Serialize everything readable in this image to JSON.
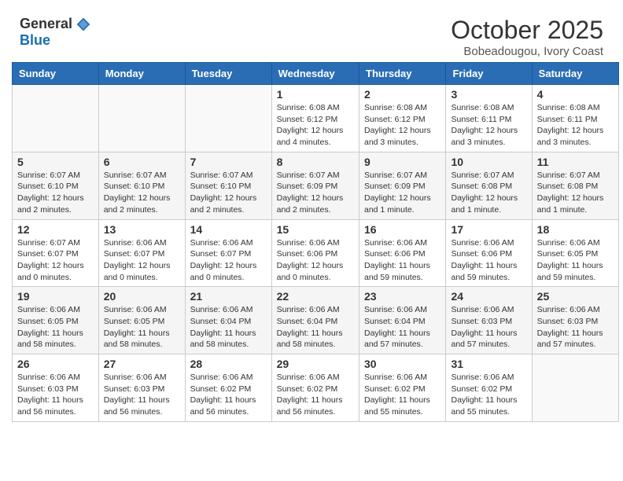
{
  "header": {
    "logo_general": "General",
    "logo_blue": "Blue",
    "month_title": "October 2025",
    "location": "Bobeadougou, Ivory Coast"
  },
  "days_of_week": [
    "Sunday",
    "Monday",
    "Tuesday",
    "Wednesday",
    "Thursday",
    "Friday",
    "Saturday"
  ],
  "weeks": [
    [
      {
        "day": "",
        "info": ""
      },
      {
        "day": "",
        "info": ""
      },
      {
        "day": "",
        "info": ""
      },
      {
        "day": "1",
        "info": "Sunrise: 6:08 AM\nSunset: 6:12 PM\nDaylight: 12 hours\nand 4 minutes."
      },
      {
        "day": "2",
        "info": "Sunrise: 6:08 AM\nSunset: 6:12 PM\nDaylight: 12 hours\nand 3 minutes."
      },
      {
        "day": "3",
        "info": "Sunrise: 6:08 AM\nSunset: 6:11 PM\nDaylight: 12 hours\nand 3 minutes."
      },
      {
        "day": "4",
        "info": "Sunrise: 6:08 AM\nSunset: 6:11 PM\nDaylight: 12 hours\nand 3 minutes."
      }
    ],
    [
      {
        "day": "5",
        "info": "Sunrise: 6:07 AM\nSunset: 6:10 PM\nDaylight: 12 hours\nand 2 minutes."
      },
      {
        "day": "6",
        "info": "Sunrise: 6:07 AM\nSunset: 6:10 PM\nDaylight: 12 hours\nand 2 minutes."
      },
      {
        "day": "7",
        "info": "Sunrise: 6:07 AM\nSunset: 6:10 PM\nDaylight: 12 hours\nand 2 minutes."
      },
      {
        "day": "8",
        "info": "Sunrise: 6:07 AM\nSunset: 6:09 PM\nDaylight: 12 hours\nand 2 minutes."
      },
      {
        "day": "9",
        "info": "Sunrise: 6:07 AM\nSunset: 6:09 PM\nDaylight: 12 hours\nand 1 minute."
      },
      {
        "day": "10",
        "info": "Sunrise: 6:07 AM\nSunset: 6:08 PM\nDaylight: 12 hours\nand 1 minute."
      },
      {
        "day": "11",
        "info": "Sunrise: 6:07 AM\nSunset: 6:08 PM\nDaylight: 12 hours\nand 1 minute."
      }
    ],
    [
      {
        "day": "12",
        "info": "Sunrise: 6:07 AM\nSunset: 6:07 PM\nDaylight: 12 hours\nand 0 minutes."
      },
      {
        "day": "13",
        "info": "Sunrise: 6:06 AM\nSunset: 6:07 PM\nDaylight: 12 hours\nand 0 minutes."
      },
      {
        "day": "14",
        "info": "Sunrise: 6:06 AM\nSunset: 6:07 PM\nDaylight: 12 hours\nand 0 minutes."
      },
      {
        "day": "15",
        "info": "Sunrise: 6:06 AM\nSunset: 6:06 PM\nDaylight: 12 hours\nand 0 minutes."
      },
      {
        "day": "16",
        "info": "Sunrise: 6:06 AM\nSunset: 6:06 PM\nDaylight: 11 hours\nand 59 minutes."
      },
      {
        "day": "17",
        "info": "Sunrise: 6:06 AM\nSunset: 6:06 PM\nDaylight: 11 hours\nand 59 minutes."
      },
      {
        "day": "18",
        "info": "Sunrise: 6:06 AM\nSunset: 6:05 PM\nDaylight: 11 hours\nand 59 minutes."
      }
    ],
    [
      {
        "day": "19",
        "info": "Sunrise: 6:06 AM\nSunset: 6:05 PM\nDaylight: 11 hours\nand 58 minutes."
      },
      {
        "day": "20",
        "info": "Sunrise: 6:06 AM\nSunset: 6:05 PM\nDaylight: 11 hours\nand 58 minutes."
      },
      {
        "day": "21",
        "info": "Sunrise: 6:06 AM\nSunset: 6:04 PM\nDaylight: 11 hours\nand 58 minutes."
      },
      {
        "day": "22",
        "info": "Sunrise: 6:06 AM\nSunset: 6:04 PM\nDaylight: 11 hours\nand 58 minutes."
      },
      {
        "day": "23",
        "info": "Sunrise: 6:06 AM\nSunset: 6:04 PM\nDaylight: 11 hours\nand 57 minutes."
      },
      {
        "day": "24",
        "info": "Sunrise: 6:06 AM\nSunset: 6:03 PM\nDaylight: 11 hours\nand 57 minutes."
      },
      {
        "day": "25",
        "info": "Sunrise: 6:06 AM\nSunset: 6:03 PM\nDaylight: 11 hours\nand 57 minutes."
      }
    ],
    [
      {
        "day": "26",
        "info": "Sunrise: 6:06 AM\nSunset: 6:03 PM\nDaylight: 11 hours\nand 56 minutes."
      },
      {
        "day": "27",
        "info": "Sunrise: 6:06 AM\nSunset: 6:03 PM\nDaylight: 11 hours\nand 56 minutes."
      },
      {
        "day": "28",
        "info": "Sunrise: 6:06 AM\nSunset: 6:02 PM\nDaylight: 11 hours\nand 56 minutes."
      },
      {
        "day": "29",
        "info": "Sunrise: 6:06 AM\nSunset: 6:02 PM\nDaylight: 11 hours\nand 56 minutes."
      },
      {
        "day": "30",
        "info": "Sunrise: 6:06 AM\nSunset: 6:02 PM\nDaylight: 11 hours\nand 55 minutes."
      },
      {
        "day": "31",
        "info": "Sunrise: 6:06 AM\nSunset: 6:02 PM\nDaylight: 11 hours\nand 55 minutes."
      },
      {
        "day": "",
        "info": ""
      }
    ]
  ]
}
